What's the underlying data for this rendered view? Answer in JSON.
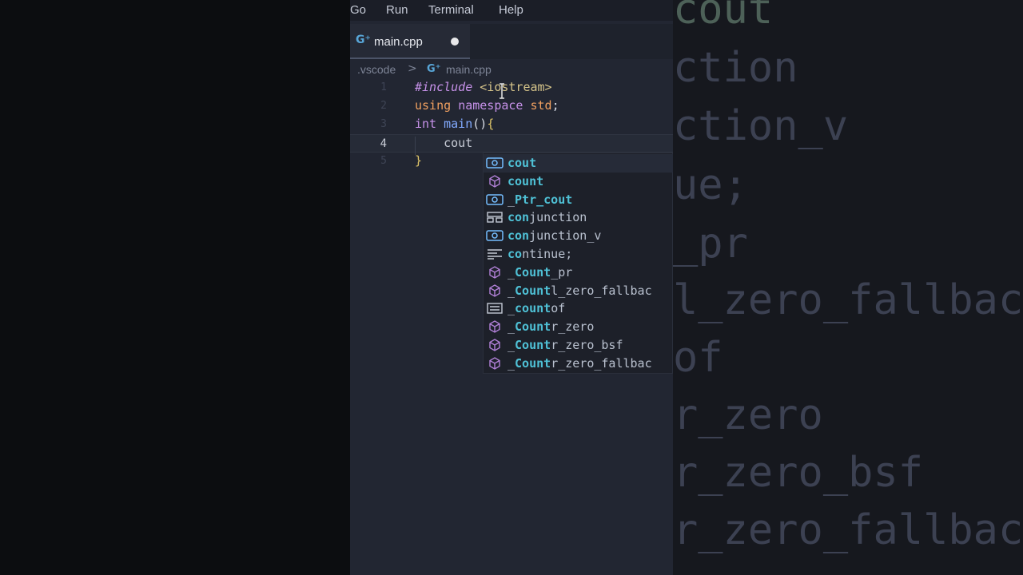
{
  "menu": [
    "Go",
    "Run",
    "Terminal",
    "Help"
  ],
  "tab": {
    "label": "main.cpp",
    "icon": "cpp-file-icon"
  },
  "breadcrumb": {
    "folder": ".vscode",
    "separator": ">",
    "file": "main.cpp"
  },
  "code": {
    "lines": [
      {
        "number": "1",
        "tokens": [
          [
            "pp",
            "#include "
          ],
          [
            "str",
            "<iostream>"
          ]
        ]
      },
      {
        "number": "2",
        "tokens": [
          [
            "kw2",
            "using "
          ],
          [
            "kw",
            "namespace "
          ],
          [
            "kw2",
            "std"
          ],
          [
            "tok",
            ";"
          ]
        ]
      },
      {
        "number": "3",
        "tokens": [
          [
            "kw",
            "int "
          ],
          [
            "fn",
            "main"
          ],
          [
            "tok",
            "()"
          ],
          [
            "brace",
            "{"
          ]
        ]
      },
      {
        "number": "4",
        "tokens": [
          [
            "typed",
            "    cout"
          ]
        ]
      },
      {
        "number": "5",
        "tokens": [
          [
            "brace",
            "}"
          ]
        ]
      }
    ],
    "active_line": "4"
  },
  "suggestions": [
    {
      "prefix": "",
      "match": "cout",
      "suffix": "",
      "icon": "variable-icon"
    },
    {
      "prefix": "",
      "match": "count",
      "suffix": "",
      "icon": "cube-icon"
    },
    {
      "prefix": "_",
      "match": "Ptr_cout",
      "suffix": "",
      "icon": "variable-icon"
    },
    {
      "prefix": "",
      "match": "con",
      "suffix": "junction",
      "icon": "struct-icon"
    },
    {
      "prefix": "",
      "match": "con",
      "suffix": "junction_v",
      "icon": "variable-icon"
    },
    {
      "prefix": "",
      "match": "co",
      "suffix": "ntinue;",
      "icon": "snippet-icon"
    },
    {
      "prefix": "_",
      "match": "Count",
      "suffix": "_pr",
      "icon": "cube-icon"
    },
    {
      "prefix": "_",
      "match": "Count",
      "suffix": "l_zero_fallbac",
      "icon": "cube-icon"
    },
    {
      "prefix": "_",
      "match": "count",
      "suffix": "of",
      "icon": "enum-icon"
    },
    {
      "prefix": "_",
      "match": "Count",
      "suffix": "r_zero",
      "icon": "cube-icon"
    },
    {
      "prefix": "_",
      "match": "Count",
      "suffix": "r_zero_bsf",
      "icon": "cube-icon"
    },
    {
      "prefix": "_",
      "match": "Count",
      "suffix": "r_zero_fallbac",
      "icon": "cube-icon"
    }
  ],
  "background_zoom": [
    "cout",
    "ction",
    "ction_v",
    "ue;",
    "_pr",
    "l_zero_fallbac",
    "of",
    "r_zero",
    "r_zero_bsf",
    "r_zero_fallbac"
  ]
}
